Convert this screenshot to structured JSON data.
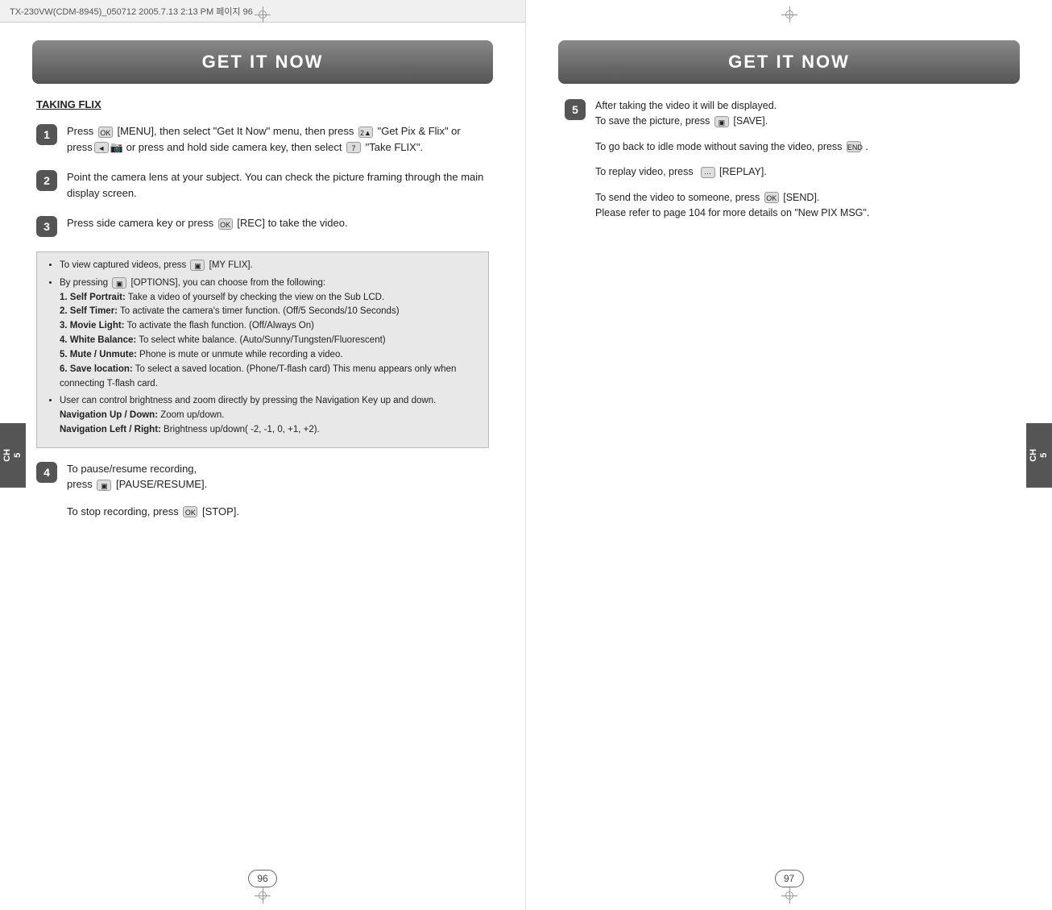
{
  "page_header": {
    "text": "TX-230VW(CDM-8945)_050712  2005.7.13  2:13 PM  페이지  96"
  },
  "left_page": {
    "header": "GET IT NOW",
    "chapter_tab": "CH\n5",
    "section_title": "TAKING FLIX",
    "steps": [
      {
        "number": "1",
        "text": "Press [MENU], then select \"Get It Now\" menu, then press \"Get Pix & Flix\" or press or press and hold side camera key, then select \"Take FLIX\"."
      },
      {
        "number": "2",
        "text": "Point the camera lens at your subject. You can check the picture framing through the main display screen."
      },
      {
        "number": "3",
        "text": "Press side camera key or press [REC] to take the video."
      }
    ],
    "info_box": {
      "bullets": [
        "To view captured videos, press  [MY FLIX].",
        "By pressing  [OPTIONS], you can choose from the following:"
      ],
      "sub_items": [
        "1. Self Portrait: Take a video of yourself by checking the view on the Sub LCD.",
        "2. Self Timer: To activate the camera's timer function. (Off/5 Seconds/10 Seconds)",
        "3. Movie Light: To activate the flash function. (Off/Always On)",
        "4. White Balance: To select white balance. (Auto/Sunny/Tungsten/Fluorescent)",
        "5. Mute / Unmute: Phone is mute or unmute while recording a video.",
        "6. Save location: To select a saved location. (Phone/T-flash card) This menu appears only when connecting T-flash card."
      ],
      "user_note": "User can control brightness and zoom directly by pressing the Navigation Key up and down.",
      "nav_notes": [
        "Navigation Up / Down: Zoom up/down.",
        "Navigation Left / Right: Brightness up/down( -2, -1, 0, +1, +2)."
      ]
    },
    "step4": {
      "number": "4",
      "text": "To pause/resume recording, press  [PAUSE/RESUME].",
      "extra": "To stop recording, press  [STOP]."
    },
    "page_number": "96"
  },
  "right_page": {
    "header": "GET IT NOW",
    "chapter_tab": "CH\n5",
    "step5": {
      "number": "5",
      "paragraphs": [
        "After taking the video it will be displayed. To save the picture, press  [SAVE].",
        "To go back to idle mode without saving the video, press  .",
        "To replay video, press   [REPLAY].",
        "To send the video to someone, press  [SEND]. Please refer to page 104 for more details on \"New PIX MSG\"."
      ]
    },
    "page_number": "97"
  },
  "icons": {
    "ok_btn": "OK",
    "menu_btn": "2▲",
    "nav_btn": "◄",
    "save_btn": "▣",
    "end_btn": "END",
    "replay_btn": "···",
    "send_btn": "OK",
    "pause_btn": "▣",
    "stop_btn": "OK",
    "myflix_btn": "▣",
    "options_btn": "▣"
  }
}
